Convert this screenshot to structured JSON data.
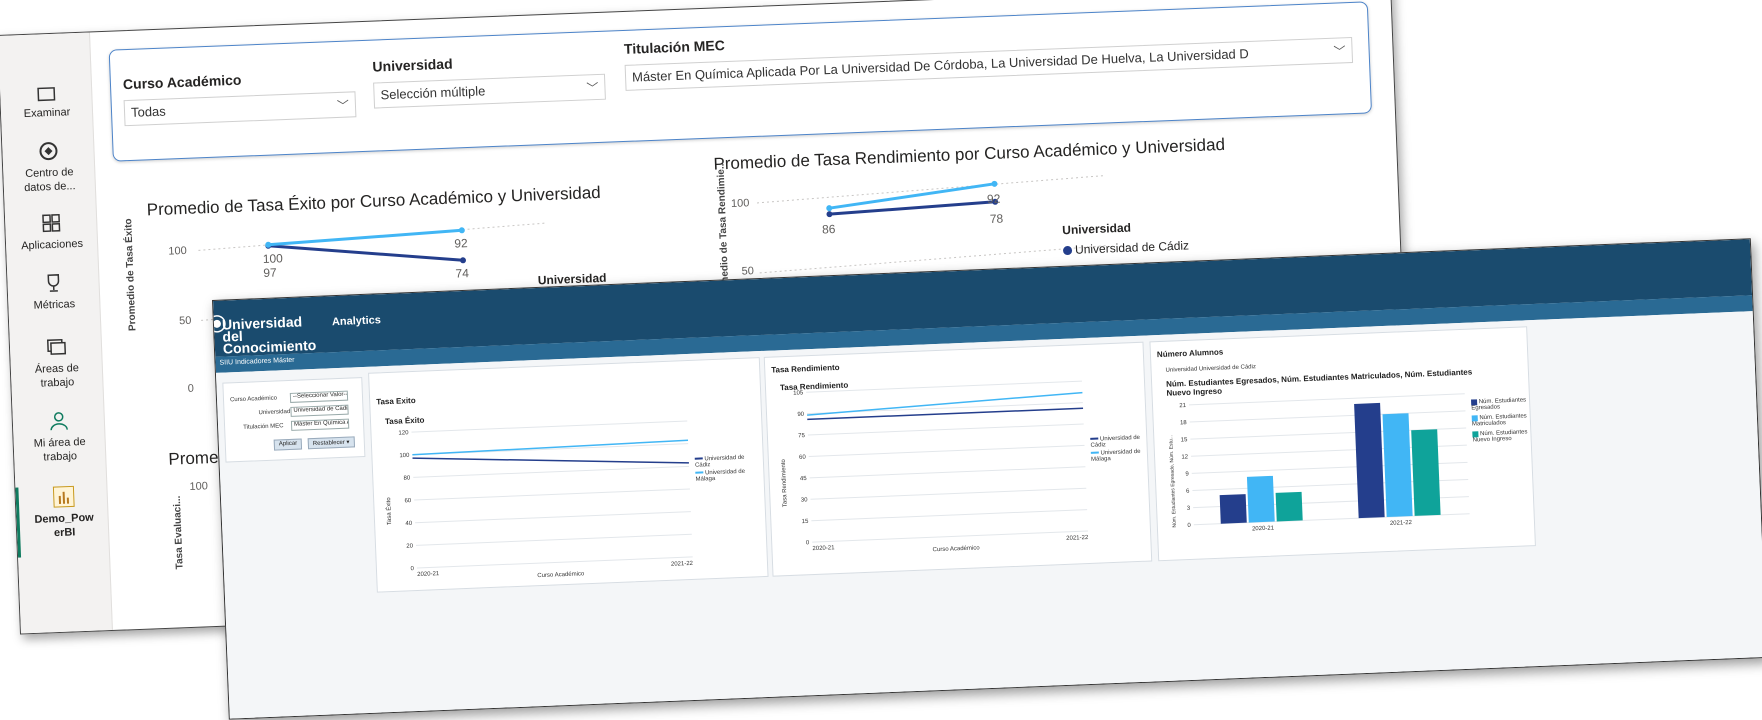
{
  "rail": {
    "items": [
      {
        "label": "Examinar",
        "icon": "folder-icon"
      },
      {
        "label": "Centro de datos de...",
        "icon": "data-hub-icon"
      },
      {
        "label": "Aplicaciones",
        "icon": "apps-icon"
      },
      {
        "label": "Métricas",
        "icon": "trophy-icon"
      },
      {
        "label": "Áreas de trabajo",
        "icon": "workspaces-icon"
      },
      {
        "label": "Mi área de trabajo",
        "icon": "person-icon"
      },
      {
        "label": "Demo_PowerBI",
        "icon": "report-icon"
      }
    ]
  },
  "filters": {
    "curso": {
      "label": "Curso Académico",
      "value": "Todas"
    },
    "universidad": {
      "label": "Universidad",
      "value": "Selección múltiple"
    },
    "titulacion": {
      "label": "Titulación MEC",
      "value": "Máster En Química Aplicada Por La Universidad De Córdoba, La Universidad De Huelva, La Universidad D"
    }
  },
  "pbi_charts": {
    "exito": {
      "title": "Promedio de Tasa Éxito por Curso Académico y Universidad",
      "ylabel": "Promedio de Tasa Éxito",
      "yticks": [
        "100",
        "50",
        "0"
      ],
      "labels": [
        "100",
        "97",
        "92",
        "74"
      ]
    },
    "rendimiento": {
      "title": "Promedio de Tasa Rendimiento por Curso Académico y Universidad",
      "ylabel": "Promedio de Tasa Rendimie...",
      "yticks": [
        "100",
        "50"
      ],
      "labels": [
        "86",
        "92",
        "78"
      ]
    },
    "third": {
      "title": "Prome",
      "ylabel": "Tasa Evaluaci...",
      "ytick": "100"
    },
    "legend": {
      "title": "Universidad",
      "items": [
        "Universidad de Cádiz",
        "Universidad de Málaga"
      ]
    }
  },
  "obiee": {
    "logo": "Universidad del Conocimiento",
    "product": "Analytics",
    "subtitle": "SIIU Indicadores Máster",
    "prompts": {
      "curso_label": "Curso Académico",
      "curso_value": "--Seleccionar Valor--",
      "univ_label": "Universidad",
      "univ_value": "Universidad de Cádi",
      "tit_label": "Titulación MEC",
      "tit_value": "Máster En Química A",
      "apply": "Aplicar",
      "reset": "Restablecer ▾"
    },
    "exito": {
      "panel": "Tasa Exito",
      "title": "Tasa Éxito",
      "ylabel": "Tasa Éxito",
      "xlabel": "Curso Académico",
      "yticks": [
        "120",
        "100",
        "80",
        "60",
        "40",
        "20",
        "0"
      ],
      "xticks": [
        "2020-21",
        "2021-22"
      ]
    },
    "rend": {
      "panel": "Tasa Rendimiento",
      "title": "Tasa Rendimiento",
      "ylabel": "Tasa Rendimiento",
      "xlabel": "Curso Académico",
      "yticks": [
        "105",
        "90",
        "75",
        "60",
        "45",
        "30",
        "15",
        "0"
      ],
      "xticks": [
        "2020-21",
        "2021-22"
      ]
    },
    "legend_univ": [
      "Universidad de Cádiz",
      "Universidad de Málaga"
    ],
    "alumnos": {
      "panel": "Número Alumnos",
      "filter": "Universidad  Universidad de Cádiz",
      "title": "Núm. Estudiantes Egresados, Núm. Estudiantes Matriculados, Núm. Estudiantes Nuevo Ingreso",
      "ylabel": "Núm. Estudiantes Egresado, Núm. Estu...",
      "yticks": [
        "21",
        "18",
        "15",
        "12",
        "9",
        "6",
        "3",
        "0"
      ],
      "xticks": [
        "2020-21",
        "2021-22"
      ],
      "legend": [
        "Núm. Estudiantes Egresados",
        "Núm. Estudiantes Matriculados",
        "Núm. Estudiantes Nuevo Ingreso"
      ]
    }
  },
  "colors": {
    "cadiz": "#243e8c",
    "malaga": "#41b6f5",
    "teal": "#0fa39a",
    "header": "#1a4b6e"
  },
  "chart_data": [
    {
      "type": "line",
      "title": "Promedio de Tasa Éxito por Curso Académico y Universidad",
      "ylabel": "Promedio de Tasa Éxito",
      "categories": [
        "2020-21",
        "2021-22"
      ],
      "ylim": [
        0,
        100
      ],
      "series": [
        {
          "name": "Universidad de Cádiz",
          "values": [
            97,
            74
          ]
        },
        {
          "name": "Universidad de Málaga",
          "values": [
            100,
            92
          ]
        }
      ]
    },
    {
      "type": "line",
      "title": "Promedio de Tasa Rendimiento por Curso Académico y Universidad",
      "ylabel": "Promedio de Tasa Rendimie...",
      "categories": [
        "2020-21",
        "2021-22"
      ],
      "ylim": [
        0,
        100
      ],
      "series": [
        {
          "name": "Universidad de Cádiz",
          "values": [
            86,
            78
          ]
        },
        {
          "name": "Universidad de Málaga",
          "values": [
            88,
            92
          ]
        }
      ]
    },
    {
      "type": "line",
      "title": "Tasa Éxito",
      "xlabel": "Curso Académico",
      "ylabel": "Tasa Éxito",
      "categories": [
        "2020-21",
        "2021-22"
      ],
      "ylim": [
        0,
        120
      ],
      "series": [
        {
          "name": "Universidad de Cádiz",
          "values": [
            97,
            83
          ]
        },
        {
          "name": "Universidad de Málaga",
          "values": [
            100,
            103
          ]
        }
      ]
    },
    {
      "type": "line",
      "title": "Tasa Rendimiento",
      "xlabel": "Curso Académico",
      "ylabel": "Tasa Rendimiento",
      "categories": [
        "2020-21",
        "2021-22"
      ],
      "ylim": [
        0,
        105
      ],
      "series": [
        {
          "name": "Universidad de Cádiz",
          "values": [
            86,
            86
          ]
        },
        {
          "name": "Universidad de Málaga",
          "values": [
            89,
            97
          ]
        }
      ]
    },
    {
      "type": "bar",
      "title": "Núm. Estudiantes Egresados, Núm. Estudiantes Matriculados, Núm. Estudiantes Nuevo Ingreso",
      "categories": [
        "2020-21",
        "2021-22"
      ],
      "ylim": [
        0,
        21
      ],
      "series": [
        {
          "name": "Núm. Estudiantes Egresados",
          "values": [
            5,
            20
          ]
        },
        {
          "name": "Núm. Estudiantes Matriculados",
          "values": [
            8,
            18
          ]
        },
        {
          "name": "Núm. Estudiantes Nuevo Ingreso",
          "values": [
            5,
            15
          ]
        }
      ]
    }
  ]
}
